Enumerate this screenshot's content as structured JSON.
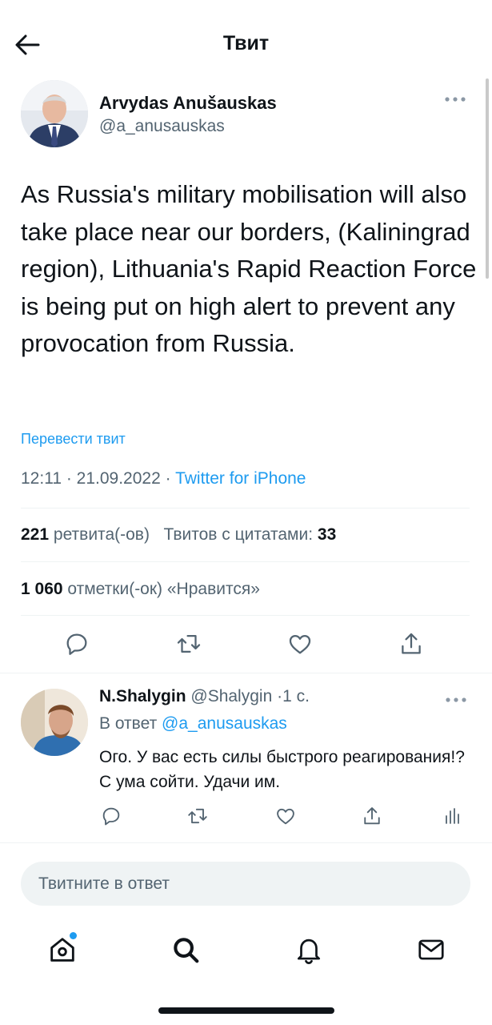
{
  "header": {
    "title": "Твит",
    "back_icon": "arrow-left-icon"
  },
  "tweet": {
    "author_name": "Arvydas Anušauskas",
    "author_handle": "@a_anusauskas",
    "text": "As Russia's military mobilisation will also take place near our borders, (Kaliningrad region), Lithuania's Rapid Reaction Force is being put on high alert to prevent any provocation from Russia.",
    "translate_label": "Перевести твит",
    "time": "12:11",
    "date": "21.09.2022",
    "source": "Twitter for iPhone",
    "retweets_count": "221",
    "retweets_label": "ретвита(-ов)",
    "quotes_label": "Твитов с цитатами:",
    "quotes_count": "33",
    "likes_count": "1 060",
    "likes_label": "отметки(-ок) «Нравится»"
  },
  "reply": {
    "name": "N.Shalygin",
    "handle": "@Shalygin",
    "time": "1 с.",
    "reply_to_prefix": "В ответ",
    "reply_to_handle": "@a_anusauskas",
    "text": "Ого. У вас есть силы быстрого реагирования!? С ума сойти. Удачи им."
  },
  "composer": {
    "placeholder": "Твитните в ответ"
  },
  "colors": {
    "accent": "#1d9bf0",
    "text": "#0f1419",
    "secondary": "#536471",
    "divider": "#eff3f4"
  },
  "tabbar": {
    "items": [
      "home-icon",
      "search-icon",
      "bell-icon",
      "mail-icon"
    ],
    "home_has_notification": true
  }
}
